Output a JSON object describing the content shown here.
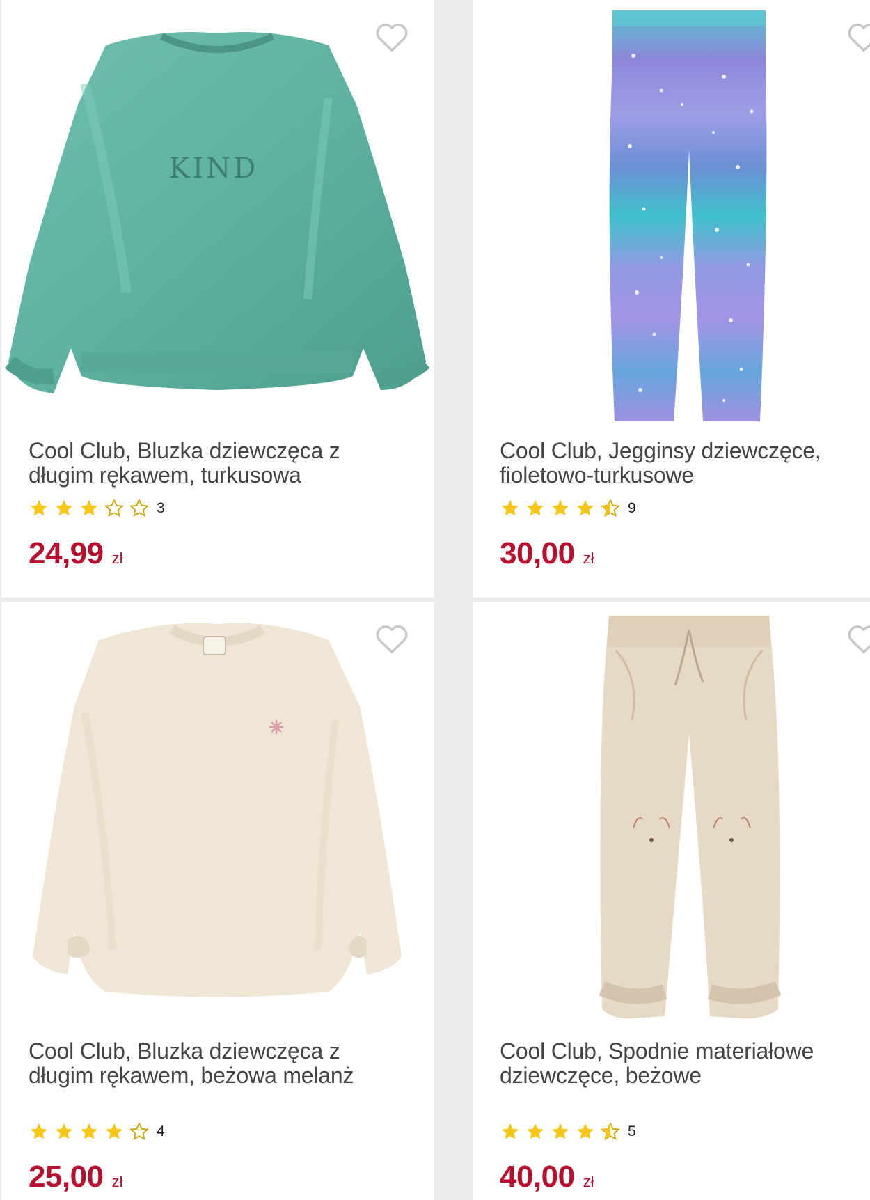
{
  "products": [
    {
      "title": "Cool Club, Bluzka dziewczęca z długim rękawem, turkusowa",
      "image_text": "KIND",
      "rating": 3,
      "rating_count": "3",
      "price": "24,99",
      "currency": "zł"
    },
    {
      "title": "Cool Club, Jegginsy dziewczęce, fioletowo-turkusowe",
      "rating": 4.5,
      "rating_count": "9",
      "price": "30,00",
      "currency": "zł"
    },
    {
      "title": "Cool Club, Bluzka dziewczęca z długim rękawem, beżowa melanż",
      "rating": 4,
      "rating_count": "4",
      "price": "25,00",
      "currency": "zł"
    },
    {
      "title": "Cool Club, Spodnie materiałowe dziewczęce, beżowe",
      "rating": 4.5,
      "rating_count": "5",
      "price": "40,00",
      "currency": "zł"
    }
  ],
  "colors": {
    "price": "#b5102e",
    "star": "#f5c518",
    "star_empty_stroke": "#c9a200",
    "title": "#444444",
    "heart_stroke": "#c8c8c8"
  },
  "icons": {
    "wishlist": "heart-outline-icon",
    "star_full": "star-filled-icon",
    "star_half": "star-half-icon",
    "star_empty": "star-outline-icon"
  }
}
